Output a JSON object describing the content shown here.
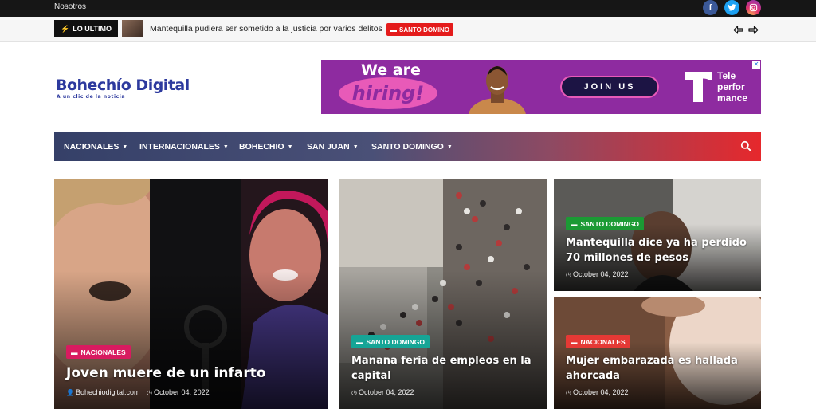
{
  "topbar": {
    "link": "Nosotros",
    "social": [
      {
        "name": "facebook-icon",
        "glyph": "f",
        "color": "#3b5998"
      },
      {
        "name": "twitter-icon",
        "glyph": "t",
        "color": "#1da1f2"
      },
      {
        "name": "instagram-icon",
        "glyph": "◎",
        "color": "#c13584"
      }
    ]
  },
  "ticker": {
    "label": "LO ULTIMO",
    "headline": "Mantequilla pudiera ser sometido a la justicia por varios delitos",
    "category": "SANTO DOMINO"
  },
  "logo": {
    "title": "Bohechío Digital",
    "tagline": "A un clic de la noticia"
  },
  "ad": {
    "we_are": "We are",
    "hiring": "hiring!",
    "cta": "JOIN US",
    "brand": [
      "Tele",
      "perfor",
      "mance"
    ]
  },
  "nav": {
    "items": [
      "NACIONALES",
      "INTERNACIONALES",
      "BOHECHIO",
      "SAN JUAN",
      "SANTO DOMINGO"
    ]
  },
  "cards": [
    {
      "category": "NACIONALES",
      "category_color": "#d81b60",
      "title": "Joven muere de un infarto",
      "author": "Bohechiodigital.com",
      "date": "October 04, 2022"
    },
    {
      "category": "SANTO DOMINGO",
      "category_color": "#16a596",
      "title": "Mañana feria de empleos en la capital",
      "date": "October 04, 2022"
    },
    {
      "category": "SANTO DOMINGO",
      "category_color": "#1b9a34",
      "title": "Mantequilla dice ya ha perdido 70 millones de pesos",
      "date": "October 04, 2022"
    },
    {
      "category": "NACIONALES",
      "category_color": "#e53935",
      "title": "Mujer embarazada es hallada ahorcada",
      "date": "October 04, 2022"
    }
  ]
}
